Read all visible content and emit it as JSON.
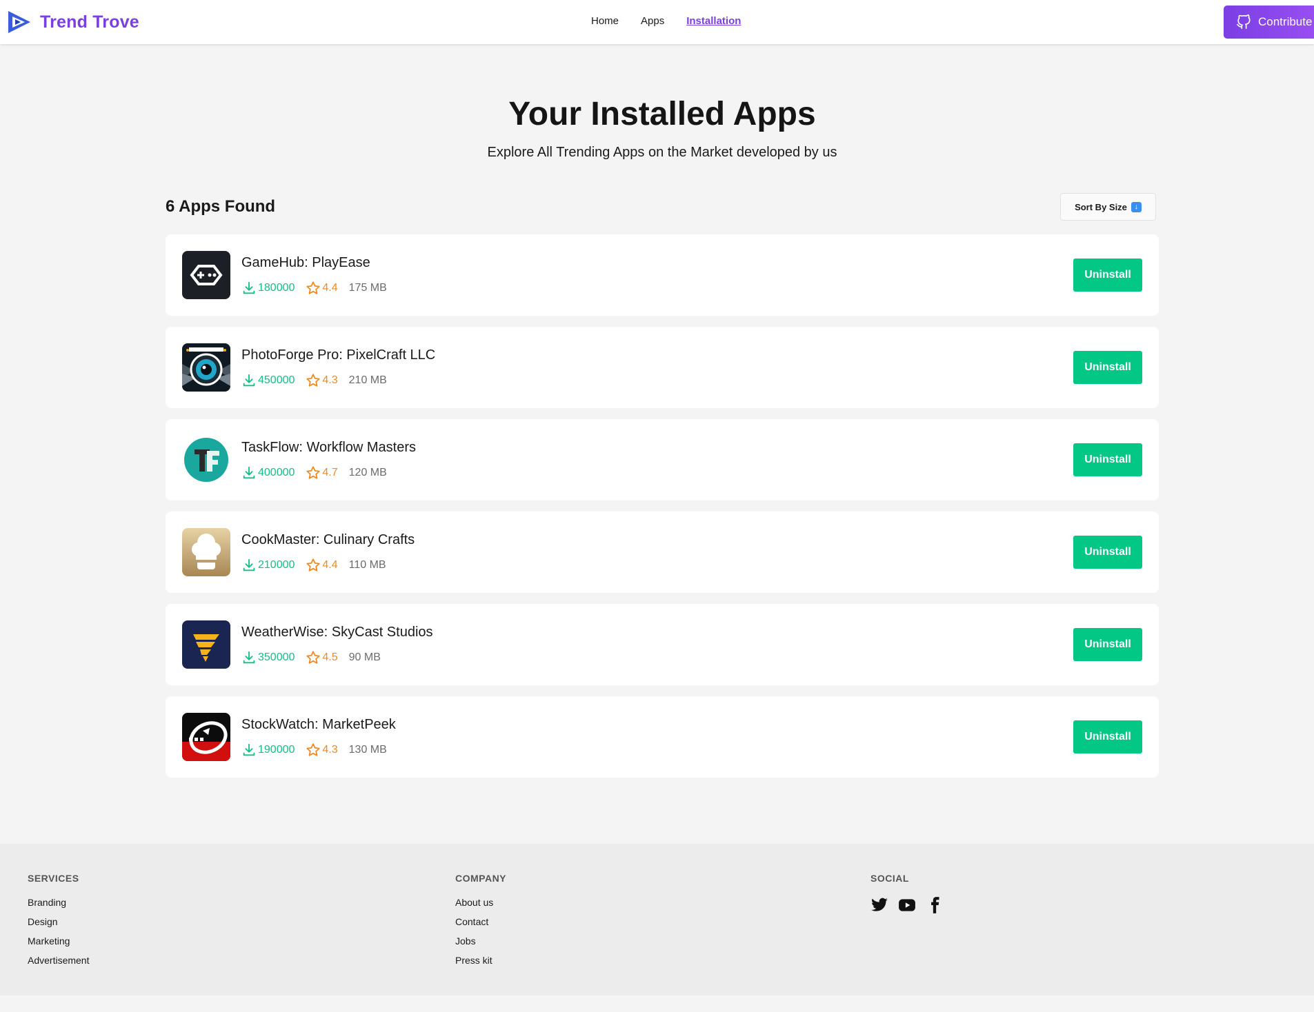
{
  "nav": {
    "brand": "Trend Trove",
    "links": [
      "Home",
      "Apps",
      "Installation"
    ],
    "active_link": "Installation",
    "contribute_label": "Contribute"
  },
  "header": {
    "title": "Your Installed Apps",
    "subtitle": "Explore All Trending Apps on the Market developed by us"
  },
  "toolbar": {
    "count_label": "6 Apps Found",
    "sort_label": "Sort By Size",
    "sort_icon": "arrow-down-icon"
  },
  "apps": [
    {
      "name": "GameHub: PlayEase",
      "downloads": "180000",
      "rating": "4.4",
      "size": "175 MB",
      "uninstall_label": "Uninstall",
      "icon": "gamepad-icon"
    },
    {
      "name": "PhotoForge Pro: PixelCraft LLC",
      "downloads": "450000",
      "rating": "4.3",
      "size": "210 MB",
      "uninstall_label": "Uninstall",
      "icon": "camera-lens-icon"
    },
    {
      "name": "TaskFlow: Workflow Masters",
      "downloads": "400000",
      "rating": "4.7",
      "size": "120 MB",
      "uninstall_label": "Uninstall",
      "icon": "tf-logo-icon"
    },
    {
      "name": "CookMaster: Culinary Crafts",
      "downloads": "210000",
      "rating": "4.4",
      "size": "110 MB",
      "uninstall_label": "Uninstall",
      "icon": "chef-hat-icon"
    },
    {
      "name": "WeatherWise: SkyCast Studios",
      "downloads": "350000",
      "rating": "4.5",
      "size": "90 MB",
      "uninstall_label": "Uninstall",
      "icon": "tornado-icon"
    },
    {
      "name": "StockWatch: MarketPeek",
      "downloads": "190000",
      "rating": "4.3",
      "size": "130 MB",
      "uninstall_label": "Uninstall",
      "icon": "stock-chart-icon"
    }
  ],
  "footer": {
    "services": {
      "title": "SERVICES",
      "links": [
        "Branding",
        "Design",
        "Marketing",
        "Advertisement"
      ]
    },
    "company": {
      "title": "COMPANY",
      "links": [
        "About us",
        "Contact",
        "Jobs",
        "Press kit"
      ]
    },
    "social": {
      "title": "SOCIAL",
      "icons": [
        "twitter-icon",
        "youtube-icon",
        "facebook-icon"
      ]
    }
  },
  "colors": {
    "brand": "#7a3fe0",
    "uninstall": "#03c784",
    "downloads": "#12c085",
    "rating": "#f08a1c"
  }
}
